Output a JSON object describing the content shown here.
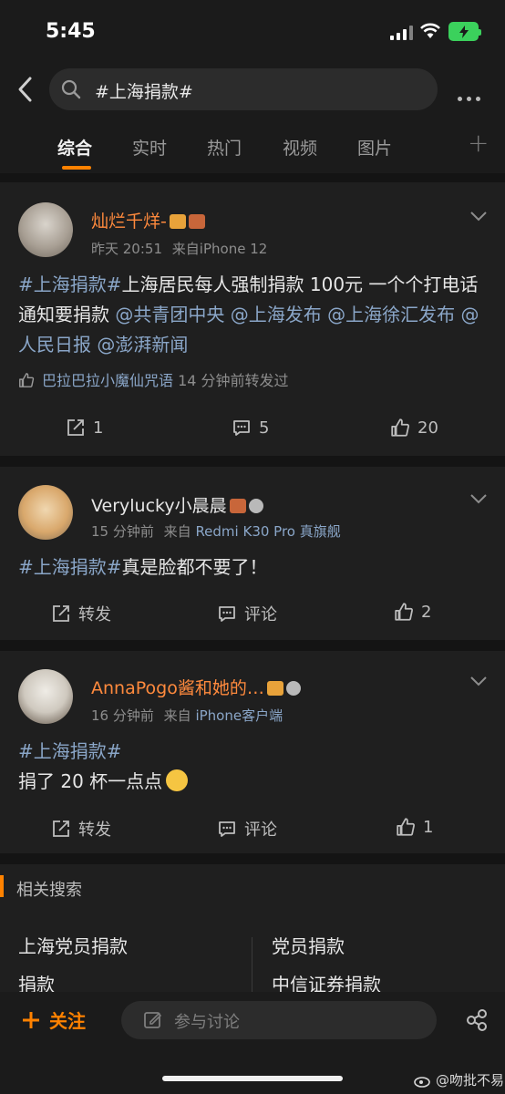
{
  "status": {
    "time": "5:45"
  },
  "search": {
    "query": "#上海捐款#"
  },
  "tabs": [
    {
      "label": "综合"
    },
    {
      "label": "实时"
    },
    {
      "label": "热门"
    },
    {
      "label": "视频"
    },
    {
      "label": "图片"
    }
  ],
  "posts": [
    {
      "username": "灿烂千烊-",
      "username_color": "#ff8a3d",
      "time": "昨天 20:51",
      "source_prefix": "来自",
      "source": "iPhone 12",
      "body_tag": "#上海捐款#",
      "body_text": "上海居民每人强制捐款 100元 一个个打电话通知要捐款",
      "mentions": [
        "@共青团中央",
        "@上海发布",
        "@上海徐汇发布",
        "@人民日报",
        "@澎湃新闻"
      ],
      "repost_name": "巴拉巴拉小魔仙咒语",
      "repost_text": "14 分钟前转发过",
      "reposts": "1",
      "comments": "5",
      "likes": "20"
    },
    {
      "username": "Verylucky小晨晨",
      "username_color": "#e6e6e6",
      "time": "15 分钟前",
      "source_prefix": "来自",
      "source": "Redmi K30 Pro 真旗舰",
      "body_tag": "#上海捐款#",
      "body_text": "真是脸都不要了！",
      "repost_label": "转发",
      "comment_label": "评论",
      "likes": "2"
    },
    {
      "username": "AnnaPogo酱和她的…",
      "username_color": "#ff8a3d",
      "time": "16 分钟前",
      "source_prefix": "来自",
      "source": "iPhone客户端",
      "body_tag": "#上海捐款#",
      "body_text": "捐了 20 杯一点点",
      "repost_label": "转发",
      "comment_label": "评论",
      "likes": "1"
    }
  ],
  "related": {
    "title": "相关搜索",
    "items": [
      "上海党员捐款",
      "党员捐款",
      "捐款",
      "中信证券捐款"
    ]
  },
  "bottom": {
    "follow": "关注",
    "discuss_placeholder": "参与讨论"
  },
  "watermark": "@吻批不易",
  "colors": {
    "accent": "#ff8200",
    "link": "#8aa6c8",
    "background": "#141414",
    "card": "#1f1f1f"
  }
}
